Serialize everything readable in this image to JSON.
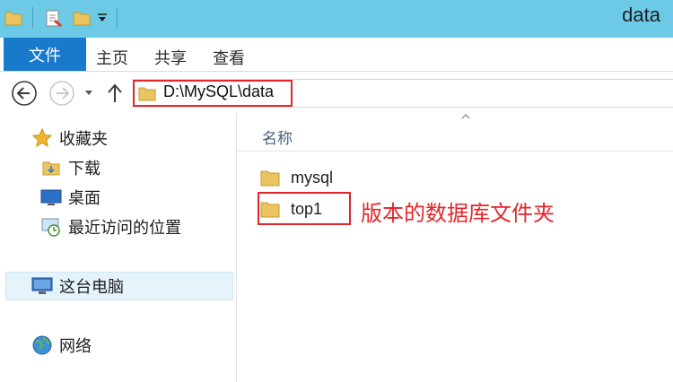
{
  "window": {
    "title": "data"
  },
  "ribbon": {
    "file_tab": "文件",
    "tabs": [
      {
        "label": "主页"
      },
      {
        "label": "共享"
      },
      {
        "label": "查看"
      }
    ]
  },
  "address": {
    "path": "D:\\MySQL\\data"
  },
  "sidebar": {
    "items": [
      {
        "label": "收藏夹",
        "icon": "star-icon"
      },
      {
        "label": "下载",
        "icon": "download-folder-icon"
      },
      {
        "label": "桌面",
        "icon": "desktop-icon"
      },
      {
        "label": "最近访问的位置",
        "icon": "recent-places-icon"
      },
      {
        "label": "这台电脑",
        "icon": "computer-icon",
        "selected": true
      },
      {
        "label": "网络",
        "icon": "network-icon"
      }
    ]
  },
  "content": {
    "column_name": "名称",
    "files": [
      {
        "name": "mysql",
        "icon": "folder-icon"
      },
      {
        "name": "top1",
        "icon": "folder-icon"
      }
    ],
    "annotation": "版本的数据库文件夹"
  },
  "colors": {
    "titlebar": "#6ccae6",
    "file_tab": "#1979ca",
    "highlight": "#e3262a",
    "folder": "#e9c460"
  }
}
